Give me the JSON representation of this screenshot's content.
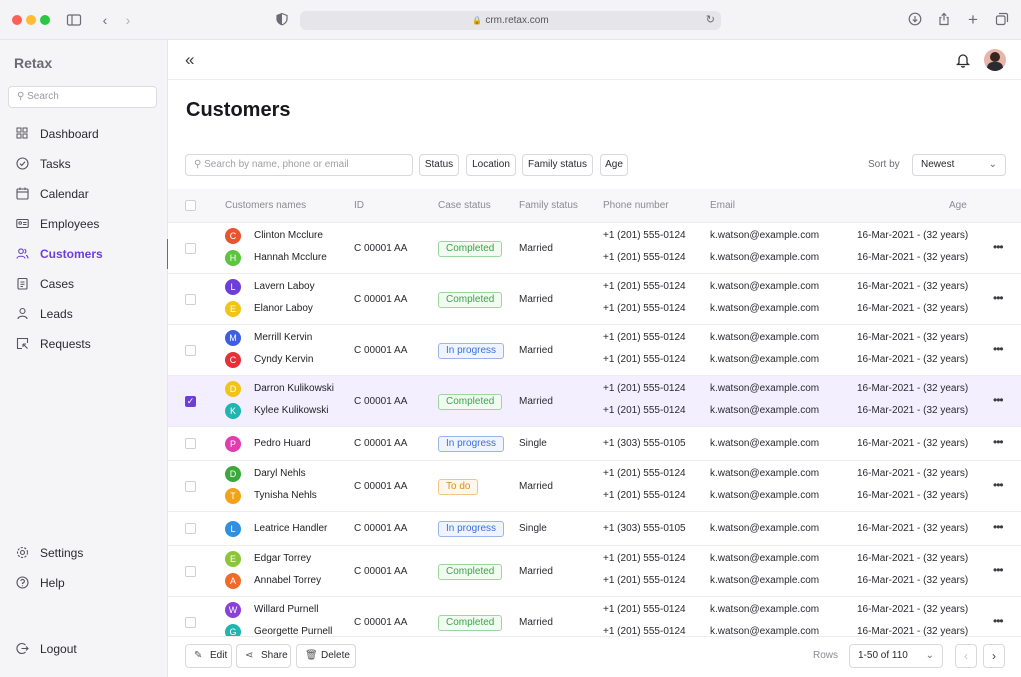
{
  "browser": {
    "url": "crm.retax.com"
  },
  "sidebar": {
    "brand": "Retax",
    "search_placeholder": "Search",
    "items": [
      {
        "label": "Dashboard",
        "icon": "grid-icon"
      },
      {
        "label": "Tasks",
        "icon": "check-circle-icon"
      },
      {
        "label": "Calendar",
        "icon": "calendar-icon"
      },
      {
        "label": "Employees",
        "icon": "id-card-icon"
      },
      {
        "label": "Customers",
        "icon": "users-icon",
        "active": true
      },
      {
        "label": "Cases",
        "icon": "clipboard-icon"
      },
      {
        "label": "Leads",
        "icon": "user-icon"
      },
      {
        "label": "Requests",
        "icon": "request-icon"
      }
    ],
    "bottom": [
      {
        "label": "Settings",
        "icon": "gear-icon"
      },
      {
        "label": "Help",
        "icon": "help-icon"
      }
    ],
    "logout": "Logout"
  },
  "page": {
    "title": "Customers",
    "search_placeholder": "Search by name, phone or email",
    "filters": [
      "Status",
      "Location",
      "Family status",
      "Age"
    ],
    "sort_label": "Sort by",
    "sort_value": "Newest"
  },
  "table": {
    "headers": [
      "Customers names",
      "ID",
      "Case status",
      "Family status",
      "Phone number",
      "Email",
      "Age"
    ],
    "rows": [
      {
        "checked": false,
        "people": [
          {
            "initial": "C",
            "name": "Clinton Mcclure",
            "color": "#e8542f",
            "phone": "+1 (201) 555-0124",
            "email": "k.watson@example.com",
            "age_date": "16-Mar-2021 - ",
            "age_years": "(32 years)"
          },
          {
            "initial": "H",
            "name": "Hannah Mcclure",
            "color": "#5cc43e",
            "phone": "+1 (201) 555-0124",
            "email": "k.watson@example.com",
            "age_date": "16-Mar-2021 - ",
            "age_years": "(32 years)"
          }
        ],
        "id": "C 00001 AA",
        "status": "Completed",
        "status_kind": "done",
        "family": "Married"
      },
      {
        "checked": false,
        "people": [
          {
            "initial": "L",
            "name": "Lavern Laboy",
            "color": "#6d3fd9",
            "phone": "+1 (201) 555-0124",
            "email": "k.watson@example.com",
            "age_date": "16-Mar-2021 - ",
            "age_years": "(32 years)"
          },
          {
            "initial": "E",
            "name": "Elanor Laboy",
            "color": "#f2c418",
            "phone": "+1 (201) 555-0124",
            "email": "k.watson@example.com",
            "age_date": "16-Mar-2021 - ",
            "age_years": "(32 years)"
          }
        ],
        "id": "C 00001 AA",
        "status": "Completed",
        "status_kind": "done",
        "family": "Married"
      },
      {
        "checked": false,
        "people": [
          {
            "initial": "M",
            "name": "Merrill Kervin",
            "color": "#3d5ee0",
            "phone": "+1 (201) 555-0124",
            "email": "k.watson@example.com",
            "age_date": "16-Mar-2021 - ",
            "age_years": "(32 years)"
          },
          {
            "initial": "C",
            "name": "Cyndy Kervin",
            "color": "#e5303a",
            "phone": "+1 (201) 555-0124",
            "email": "k.watson@example.com",
            "age_date": "16-Mar-2021 - ",
            "age_years": "(32 years)"
          }
        ],
        "id": "C 00001 AA",
        "status": "In progress",
        "status_kind": "prog",
        "family": "Married"
      },
      {
        "checked": true,
        "people": [
          {
            "initial": "D",
            "name": "Darron Kulikowski",
            "color": "#f2c418",
            "phone": "+1 (201) 555-0124",
            "email": "k.watson@example.com",
            "age_date": "16-Mar-2021 - ",
            "age_years": "(32 years)"
          },
          {
            "initial": "K",
            "name": "Kylee Kulikowski",
            "color": "#1fb5b0",
            "phone": "+1 (201) 555-0124",
            "email": "k.watson@example.com",
            "age_date": "16-Mar-2021 - ",
            "age_years": "(32 years)"
          }
        ],
        "id": "C 00001 AA",
        "status": "Completed",
        "status_kind": "done",
        "family": "Married"
      },
      {
        "checked": false,
        "people": [
          {
            "initial": "P",
            "name": "Pedro Huard",
            "color": "#e33bb0",
            "phone": "+1 (303) 555-0105",
            "email": "k.watson@example.com",
            "age_date": "16-Mar-2021 - ",
            "age_years": "(32 years)"
          }
        ],
        "id": "C 00001 AA",
        "status": "In progress",
        "status_kind": "prog",
        "family": "Single"
      },
      {
        "checked": false,
        "people": [
          {
            "initial": "D",
            "name": "Daryl Nehls",
            "color": "#3aa83a",
            "phone": "+1 (201) 555-0124",
            "email": "k.watson@example.com",
            "age_date": "16-Mar-2021 - ",
            "age_years": "(32 years)"
          },
          {
            "initial": "T",
            "name": "Tynisha Nehls",
            "color": "#f2a218",
            "phone": "+1 (201) 555-0124",
            "email": "k.watson@example.com",
            "age_date": "16-Mar-2021 - ",
            "age_years": "(32 years)"
          }
        ],
        "id": "C 00001 AA",
        "status": "To do",
        "status_kind": "todo",
        "family": "Married"
      },
      {
        "checked": false,
        "people": [
          {
            "initial": "L",
            "name": "Leatrice Handler",
            "color": "#2f8fe0",
            "phone": "+1 (303) 555-0105",
            "email": "k.watson@example.com",
            "age_date": "16-Mar-2021 - ",
            "age_years": "(32 years)"
          }
        ],
        "id": "C 00001 AA",
        "status": "In progress",
        "status_kind": "prog",
        "family": "Single"
      },
      {
        "checked": false,
        "people": [
          {
            "initial": "E",
            "name": "Edgar Torrey",
            "color": "#8cc43a",
            "phone": "+1 (201) 555-0124",
            "email": "k.watson@example.com",
            "age_date": "16-Mar-2021 - ",
            "age_years": "(32 years)"
          },
          {
            "initial": "A",
            "name": "Annabel Torrey",
            "color": "#f06a2a",
            "phone": "+1 (201) 555-0124",
            "email": "k.watson@example.com",
            "age_date": "16-Mar-2021 - ",
            "age_years": "(32 years)"
          }
        ],
        "id": "C 00001 AA",
        "status": "Completed",
        "status_kind": "done",
        "family": "Married"
      },
      {
        "checked": false,
        "people": [
          {
            "initial": "W",
            "name": "Willard Purnell",
            "color": "#8a3fd9",
            "phone": "+1 (201) 555-0124",
            "email": "k.watson@example.com",
            "age_date": "16-Mar-2021 - ",
            "age_years": "(32 years)"
          },
          {
            "initial": "G",
            "name": "Georgette Purnell",
            "color": "#1fb5b0",
            "phone": "+1 (201) 555-0124",
            "email": "k.watson@example.com",
            "age_date": "16-Mar-2021 - ",
            "age_years": "(32 years)"
          }
        ],
        "id": "C 00001 AA",
        "status": "Completed",
        "status_kind": "done",
        "family": "Married"
      }
    ]
  },
  "footer": {
    "edit": "Edit",
    "share": "Share",
    "delete": "Delete",
    "rows_label": "Rows",
    "rows_value": "1-50 of 110"
  }
}
